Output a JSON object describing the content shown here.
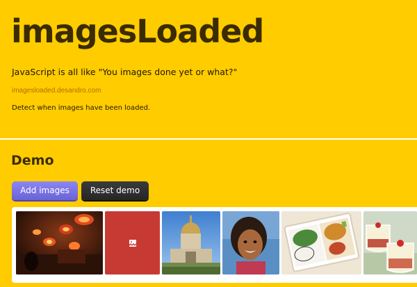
{
  "header": {
    "title": "imagesLoaded",
    "tagline": "JavaScript is all like \"You images done yet or what?\"",
    "site_link": "imagesloaded.desandro.com",
    "description": "Detect when images have been loaded."
  },
  "demo": {
    "section_title": "Demo",
    "add_button": "Add images",
    "reset_button": "Reset demo"
  },
  "gallery": {
    "images": [
      {
        "subject": "lamp-shop-photo"
      },
      {
        "subject": "broken-image",
        "icon": "broken-image-icon"
      },
      {
        "subject": "domed-building-photo"
      },
      {
        "subject": "smiling-child-photo"
      },
      {
        "subject": "bento-box-photo"
      },
      {
        "subject": "dessert-cups-photo"
      }
    ]
  },
  "colors": {
    "background": "#FFCC00",
    "add_button": "#7A74E6",
    "reset_button": "#2E2E2E",
    "broken_tile": "#C73A34",
    "link": "#B86B00"
  }
}
